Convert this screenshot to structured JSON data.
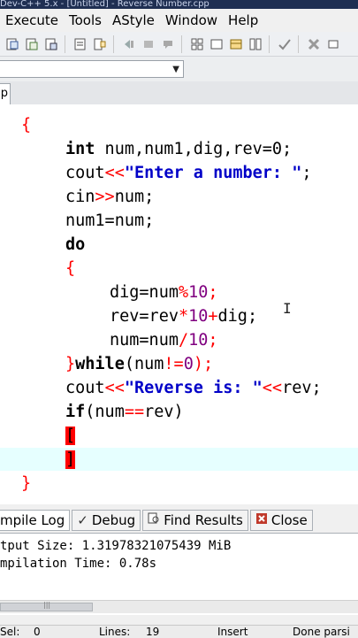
{
  "window": {
    "title": "Dev-C++ 5.x - [Untitled] - Reverse Number.cpp"
  },
  "menubar": {
    "items": [
      "Execute",
      "Tools",
      "AStyle",
      "Window",
      "Help"
    ]
  },
  "editor": {
    "tab_label": "p",
    "lines": [
      {
        "t1": "{"
      },
      {
        "k": "int",
        "rest": " num,num1,dig,rev=0;"
      },
      {
        "a": "cout",
        "op": "<<",
        "s": "\"Enter a number: \"",
        "end": ";"
      },
      {
        "a": "cin",
        "op": ">>",
        "b": "num;"
      },
      {
        "a": "num1=num;"
      },
      {
        "k": "do"
      },
      {
        "t1": "{"
      },
      {
        "a": "dig=num",
        "op": "%",
        "n": "10",
        "end": ";"
      },
      {
        "a": "rev=rev",
        "op": "*",
        "n": "10",
        "op2": "+",
        "b": "dig;"
      },
      {
        "a": "num=num",
        "op": "/",
        "n": "10",
        "end": ";"
      },
      {
        "t1": "}",
        "k": "while",
        "a": "(num",
        "op": "!=",
        "n": "0",
        "end": ");"
      },
      {
        "a": "cout",
        "op": "<<",
        "s": "\"Reverse is: \"",
        "op2": "<<",
        "b": "rev;"
      },
      {
        "k": "if",
        "a": "(num",
        "op": "==",
        "b": "rev)"
      },
      {
        "cursor": "["
      },
      {
        "cursor": "]"
      },
      {
        "t1": "}"
      }
    ]
  },
  "bottom": {
    "tabs": [
      {
        "label": "mpile Log",
        "icon": "compile-log-icon"
      },
      {
        "label": "Debug",
        "icon": "check-icon"
      },
      {
        "label": "Find Results",
        "icon": "find-icon"
      },
      {
        "label": "Close",
        "icon": "close-icon"
      }
    ],
    "log": [
      "tput Size: 1.31978321075439 MiB",
      "mpilation Time: 0.78s"
    ]
  },
  "status": {
    "sel_label": "Sel:",
    "sel_value": "0",
    "lines_label": "Lines:",
    "lines_value": "19",
    "mode": "Insert",
    "message": "Done parsi"
  },
  "colors": {
    "keyword": "#000000",
    "operator": "#ff0000",
    "number": "#800080",
    "string": "#0000c8",
    "current_line": "#e6ffff"
  }
}
